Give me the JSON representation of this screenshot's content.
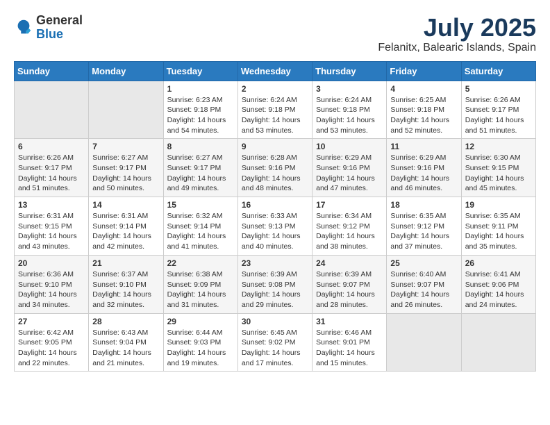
{
  "header": {
    "logo_general": "General",
    "logo_blue": "Blue",
    "month_title": "July 2025",
    "location": "Felanitx, Balearic Islands, Spain"
  },
  "weekdays": [
    "Sunday",
    "Monday",
    "Tuesday",
    "Wednesday",
    "Thursday",
    "Friday",
    "Saturday"
  ],
  "weeks": [
    [
      null,
      null,
      {
        "day": 1,
        "sunrise": "6:23 AM",
        "sunset": "9:18 PM",
        "daylight": "14 hours and 54 minutes."
      },
      {
        "day": 2,
        "sunrise": "6:24 AM",
        "sunset": "9:18 PM",
        "daylight": "14 hours and 53 minutes."
      },
      {
        "day": 3,
        "sunrise": "6:24 AM",
        "sunset": "9:18 PM",
        "daylight": "14 hours and 53 minutes."
      },
      {
        "day": 4,
        "sunrise": "6:25 AM",
        "sunset": "9:18 PM",
        "daylight": "14 hours and 52 minutes."
      },
      {
        "day": 5,
        "sunrise": "6:26 AM",
        "sunset": "9:17 PM",
        "daylight": "14 hours and 51 minutes."
      }
    ],
    [
      {
        "day": 6,
        "sunrise": "6:26 AM",
        "sunset": "9:17 PM",
        "daylight": "14 hours and 51 minutes."
      },
      {
        "day": 7,
        "sunrise": "6:27 AM",
        "sunset": "9:17 PM",
        "daylight": "14 hours and 50 minutes."
      },
      {
        "day": 8,
        "sunrise": "6:27 AM",
        "sunset": "9:17 PM",
        "daylight": "14 hours and 49 minutes."
      },
      {
        "day": 9,
        "sunrise": "6:28 AM",
        "sunset": "9:16 PM",
        "daylight": "14 hours and 48 minutes."
      },
      {
        "day": 10,
        "sunrise": "6:29 AM",
        "sunset": "9:16 PM",
        "daylight": "14 hours and 47 minutes."
      },
      {
        "day": 11,
        "sunrise": "6:29 AM",
        "sunset": "9:16 PM",
        "daylight": "14 hours and 46 minutes."
      },
      {
        "day": 12,
        "sunrise": "6:30 AM",
        "sunset": "9:15 PM",
        "daylight": "14 hours and 45 minutes."
      }
    ],
    [
      {
        "day": 13,
        "sunrise": "6:31 AM",
        "sunset": "9:15 PM",
        "daylight": "14 hours and 43 minutes."
      },
      {
        "day": 14,
        "sunrise": "6:31 AM",
        "sunset": "9:14 PM",
        "daylight": "14 hours and 42 minutes."
      },
      {
        "day": 15,
        "sunrise": "6:32 AM",
        "sunset": "9:14 PM",
        "daylight": "14 hours and 41 minutes."
      },
      {
        "day": 16,
        "sunrise": "6:33 AM",
        "sunset": "9:13 PM",
        "daylight": "14 hours and 40 minutes."
      },
      {
        "day": 17,
        "sunrise": "6:34 AM",
        "sunset": "9:12 PM",
        "daylight": "14 hours and 38 minutes."
      },
      {
        "day": 18,
        "sunrise": "6:35 AM",
        "sunset": "9:12 PM",
        "daylight": "14 hours and 37 minutes."
      },
      {
        "day": 19,
        "sunrise": "6:35 AM",
        "sunset": "9:11 PM",
        "daylight": "14 hours and 35 minutes."
      }
    ],
    [
      {
        "day": 20,
        "sunrise": "6:36 AM",
        "sunset": "9:10 PM",
        "daylight": "14 hours and 34 minutes."
      },
      {
        "day": 21,
        "sunrise": "6:37 AM",
        "sunset": "9:10 PM",
        "daylight": "14 hours and 32 minutes."
      },
      {
        "day": 22,
        "sunrise": "6:38 AM",
        "sunset": "9:09 PM",
        "daylight": "14 hours and 31 minutes."
      },
      {
        "day": 23,
        "sunrise": "6:39 AM",
        "sunset": "9:08 PM",
        "daylight": "14 hours and 29 minutes."
      },
      {
        "day": 24,
        "sunrise": "6:39 AM",
        "sunset": "9:07 PM",
        "daylight": "14 hours and 28 minutes."
      },
      {
        "day": 25,
        "sunrise": "6:40 AM",
        "sunset": "9:07 PM",
        "daylight": "14 hours and 26 minutes."
      },
      {
        "day": 26,
        "sunrise": "6:41 AM",
        "sunset": "9:06 PM",
        "daylight": "14 hours and 24 minutes."
      }
    ],
    [
      {
        "day": 27,
        "sunrise": "6:42 AM",
        "sunset": "9:05 PM",
        "daylight": "14 hours and 22 minutes."
      },
      {
        "day": 28,
        "sunrise": "6:43 AM",
        "sunset": "9:04 PM",
        "daylight": "14 hours and 21 minutes."
      },
      {
        "day": 29,
        "sunrise": "6:44 AM",
        "sunset": "9:03 PM",
        "daylight": "14 hours and 19 minutes."
      },
      {
        "day": 30,
        "sunrise": "6:45 AM",
        "sunset": "9:02 PM",
        "daylight": "14 hours and 17 minutes."
      },
      {
        "day": 31,
        "sunrise": "6:46 AM",
        "sunset": "9:01 PM",
        "daylight": "14 hours and 15 minutes."
      },
      null,
      null
    ]
  ]
}
